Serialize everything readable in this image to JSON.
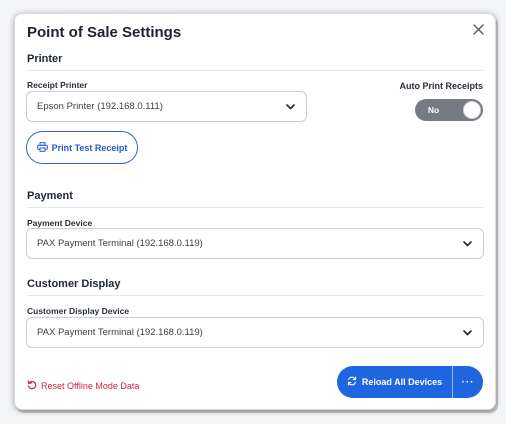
{
  "modal": {
    "title": "Point of Sale Settings"
  },
  "printer": {
    "section_title": "Printer",
    "receipt_printer_label": "Receipt Printer",
    "receipt_printer_value": "Epson Printer (192.168.0.111)",
    "auto_print_label": "Auto Print Receipts",
    "auto_print_state": "No",
    "test_button_label": "Print Test Receipt"
  },
  "payment": {
    "section_title": "Payment",
    "device_label": "Payment Device",
    "device_value": "PAX Payment Terminal (192.168.0.119)"
  },
  "customer_display": {
    "section_title": "Customer Display",
    "device_label": "Customer Display Device",
    "device_value": "PAX Payment Terminal (192.168.0.119)"
  },
  "footer": {
    "reset_label": "Reset Offline Mode Data",
    "reload_label": "Reload All Devices",
    "more_label": "···"
  },
  "colors": {
    "primary": "#1f65e0",
    "danger": "#d0263a",
    "toggle_off": "#757a83"
  },
  "icons": [
    "close-icon",
    "chevron-down-icon",
    "printer-icon",
    "reset-icon",
    "refresh-icon",
    "more-icon"
  ]
}
